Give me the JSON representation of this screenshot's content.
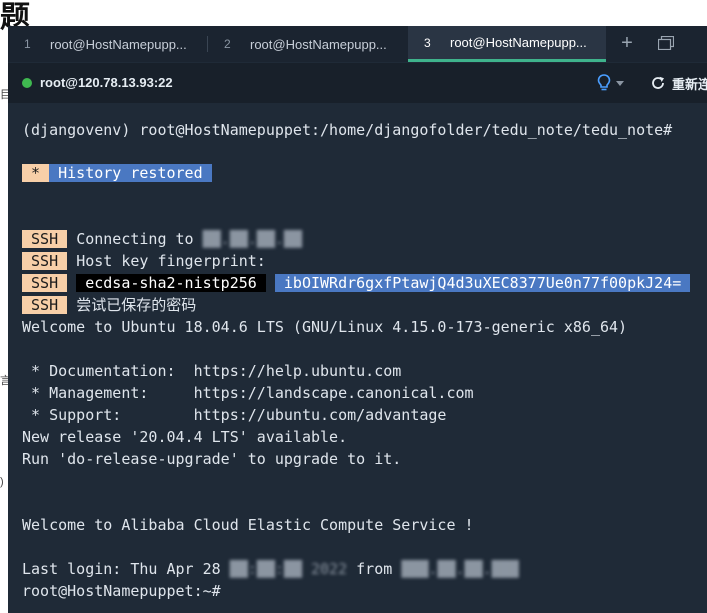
{
  "background": {
    "title_fragment": "题",
    "left_glyphs": [
      "目",
      "言",
      ")"
    ]
  },
  "tabs": [
    {
      "num": "1",
      "label": "root@HostNamepupp..."
    },
    {
      "num": "2",
      "label": "root@HostNamepupp..."
    },
    {
      "num": "3",
      "label": "root@HostNamepupp...",
      "active": true
    }
  ],
  "toolbar": {
    "new_tab_icon": "plus-icon",
    "window_icon": "windows-icon"
  },
  "session": {
    "status": "connected",
    "host": "root@120.78.13.93:22",
    "bulb_icon": "bulb-icon",
    "reconnect_label": "重新连"
  },
  "terminal": {
    "prompt1": "(djangovenv) root@HostNamepuppet:/home/djangofolder/tedu_note/tedu_note#",
    "history_mark": "*",
    "history_text": "History restored",
    "ssh_tag": "SSH",
    "ssh_connecting": "Connecting to",
    "ssh_connecting_ip": "██.██.██.██",
    "ssh_fingerprint": "Host key fingerprint:",
    "ssh_algo": "ecdsa-sha2-nistp256",
    "ssh_hash": "ibOIWRdr6gxfPtawjQ4d3uXEC8377Ue0n77f00pkJ24=",
    "ssh_password": "尝试已保存的密码",
    "welcome_ubuntu": "Welcome to Ubuntu 18.04.6 LTS (GNU/Linux 4.15.0-173-generic x86_64)",
    "doc": " * Documentation:  https://help.ubuntu.com",
    "mgmt": " * Management:     https://landscape.canonical.com",
    "support": " * Support:        https://ubuntu.com/advantage",
    "new_release": "New release '20.04.4 LTS' available.",
    "run_upgrade": "Run 'do-release-upgrade' to upgrade to it.",
    "welcome_alibaba": "Welcome to Alibaba Cloud Elastic Compute Service !",
    "last_login_prefix": "Last login: Thu Apr 28",
    "last_login_time": "██:██:██",
    "last_login_year": "2022",
    "last_login_from": "from",
    "last_login_ip": "███.██.██.███",
    "prompt2": "root@HostNamepuppet:~#"
  },
  "colors": {
    "window_bg": "#1f2a37",
    "tab_active_underline": "#3fb38c",
    "status_green": "#3fb950",
    "highlight_blue": "#4a78c2",
    "highlight_peach": "#f7cfa8"
  }
}
